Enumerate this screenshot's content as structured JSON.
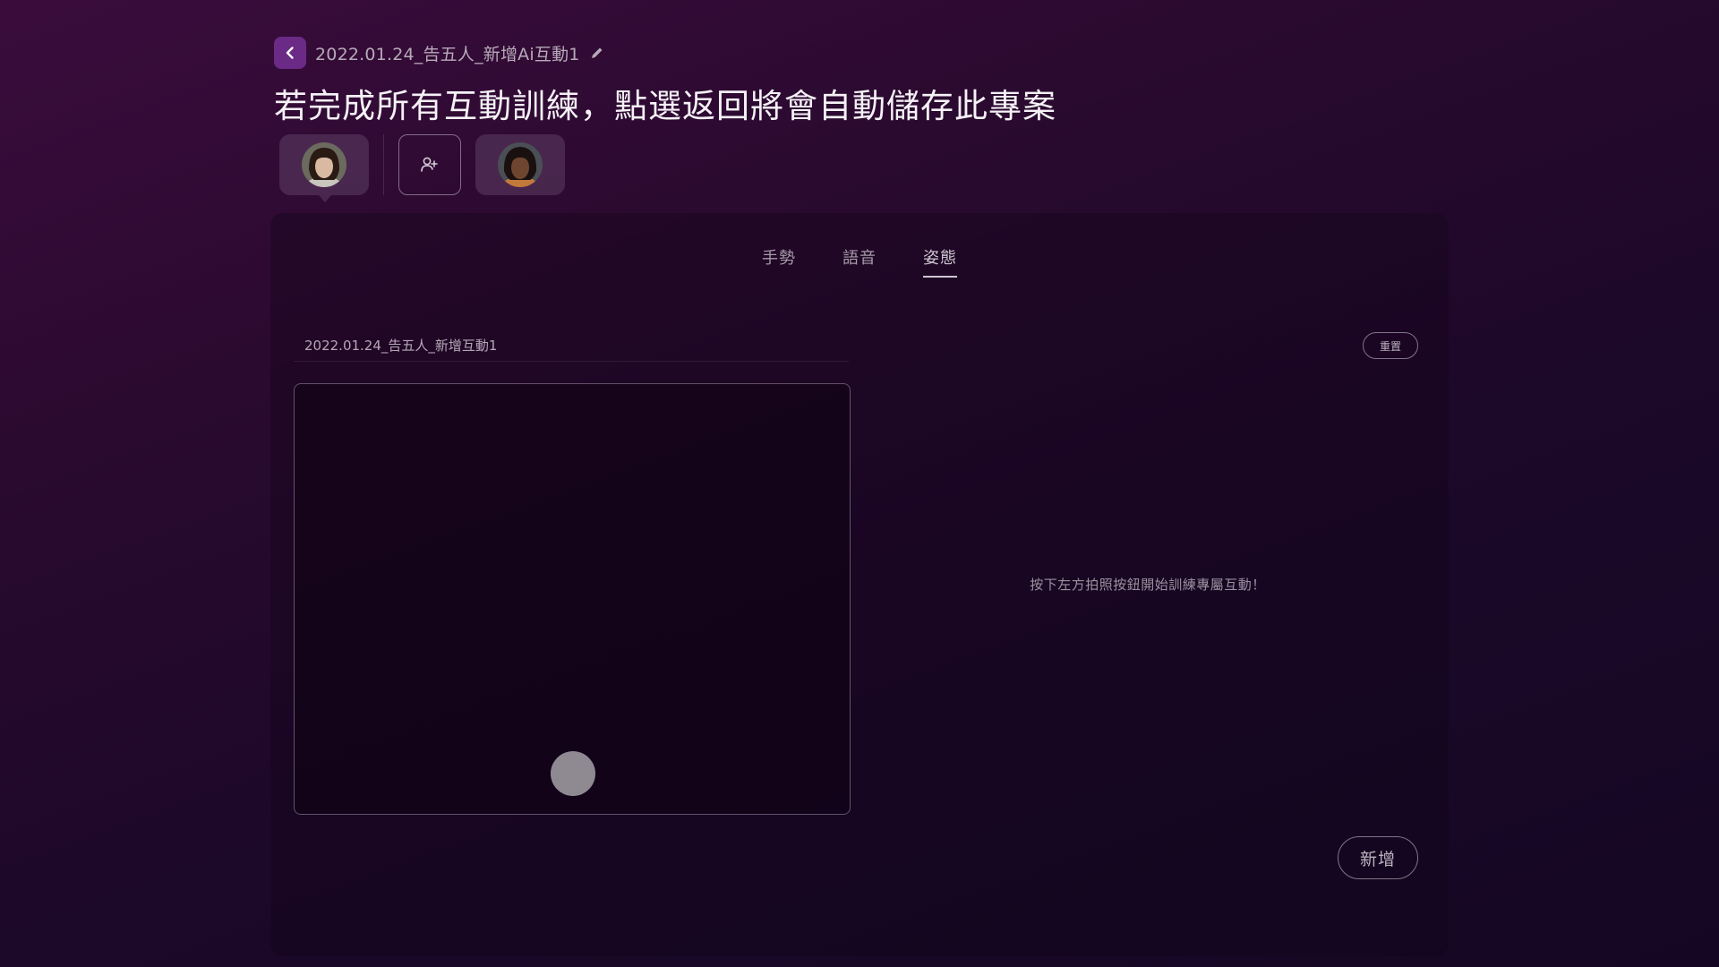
{
  "header": {
    "project_name": "2022.01.24_告五人_新增Ai互動1",
    "title": "若完成所有互動訓練，點選返回將會自動儲存此專案"
  },
  "avatars": [
    {
      "name": "avatar-1",
      "active": true
    },
    {
      "name": "avatar-2",
      "active": false
    }
  ],
  "icons": {
    "back": "chevron-left-icon",
    "edit": "pencil-icon",
    "add_person": "user-plus-icon"
  },
  "tabs": [
    {
      "label": "手勢",
      "active": false
    },
    {
      "label": "語音",
      "active": false
    },
    {
      "label": "姿態",
      "active": true
    }
  ],
  "content": {
    "project_label": "2022.01.24_告五人_新增互動1",
    "reset_label": "重置",
    "hint": "按下左方拍照按鈕開始訓練專屬互動！",
    "add_label": "新增"
  },
  "colors": {
    "back_button": "#6a2a86",
    "shutter": "#8f8a92"
  }
}
